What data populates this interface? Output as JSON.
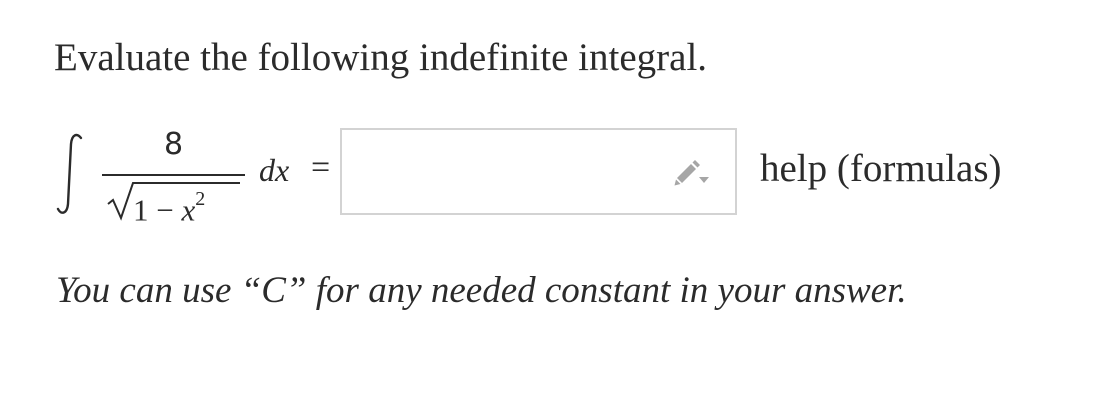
{
  "prompt": "Evaluate the following indefinite integral.",
  "problem": {
    "integral_symbol": "∫",
    "numerator": "8",
    "radicand_constant": "1",
    "radicand_operator": "−",
    "radicand_variable": "x",
    "radicand_exponent": "2",
    "differential": "dx",
    "equals": "="
  },
  "answer": {
    "value": "",
    "placeholder": "",
    "icon": "pencil-icon"
  },
  "help_link": "help (formulas)",
  "hint": "You can use “C” for any needed constant in your answer.",
  "colors": {
    "text": "#2b2b2b",
    "input_border": "#d3d3d3",
    "icon": "#a6a6a6"
  }
}
